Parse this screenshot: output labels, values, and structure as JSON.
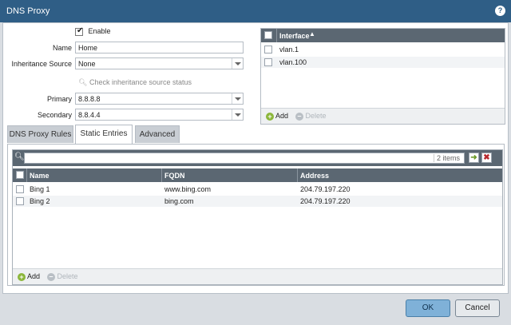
{
  "window": {
    "title": "DNS Proxy"
  },
  "general": {
    "enable_label": "Enable",
    "name_label": "Name",
    "name_value": "Home",
    "inheritance_label": "Inheritance Source",
    "inheritance_value": "None",
    "check_link": "Check inheritance source status",
    "primary_label": "Primary",
    "primary_value": "8.8.8.8",
    "secondary_label": "Secondary",
    "secondary_value": "8.8.4.4"
  },
  "interfaces": {
    "header": "Interface",
    "rows": [
      "vlan.1",
      "vlan.100"
    ],
    "add_label": "Add",
    "delete_label": "Delete"
  },
  "tabs": [
    "DNS Proxy Rules",
    "Static Entries",
    "Advanced"
  ],
  "static_entries": {
    "items_count": "2 items",
    "columns": [
      "Name",
      "FQDN",
      "Address"
    ],
    "rows": [
      {
        "name": "Bing 1",
        "fqdn": "www.bing.com",
        "address": "204.79.197.220"
      },
      {
        "name": "Bing 2",
        "fqdn": "bing.com",
        "address": "204.79.197.220"
      }
    ],
    "add_label": "Add",
    "delete_label": "Delete"
  },
  "footer": {
    "ok_label": "OK",
    "cancel_label": "Cancel"
  },
  "colors": {
    "titlebar": "#2f5e86",
    "grid_header": "#5b6772",
    "ok_button": "#7fb1d8"
  }
}
